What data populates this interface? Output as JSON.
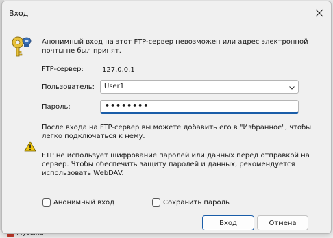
{
  "dialog": {
    "title": "Вход",
    "intro_text": "Анонимный вход на этот FTP-сервер невозможен или адрес электронной почты не был принят.",
    "server_label": "FTP-сервер:",
    "server_value": "127.0.0.1",
    "user_label": "Пользователь:",
    "user_value": "User1",
    "password_label": "Пароль:",
    "password_value": "••••••••",
    "favorites_text": "После входа на FTP-сервер вы можете добавить его в \"Избранное\", чтобы легко подключаться к нему.",
    "warning_text": "FTP не использует шифрование паролей или данных перед отправкой на сервер. Чтобы обеспечить защиту паролей и данных, рекомендуется использовать WebDAV.",
    "anonymous_label": "Анонимный вход",
    "save_password_label": "Сохранить пароль",
    "login_button": "Вход",
    "cancel_button": "Отмена"
  },
  "background": {
    "partial_text": "Музыка"
  },
  "icons": {
    "close": "close-icon",
    "key": "key-icon",
    "warning": "warning-icon",
    "chevron": "chevron-down-icon"
  },
  "colors": {
    "accent": "#1a5da8",
    "warning": "#f2c80f"
  }
}
